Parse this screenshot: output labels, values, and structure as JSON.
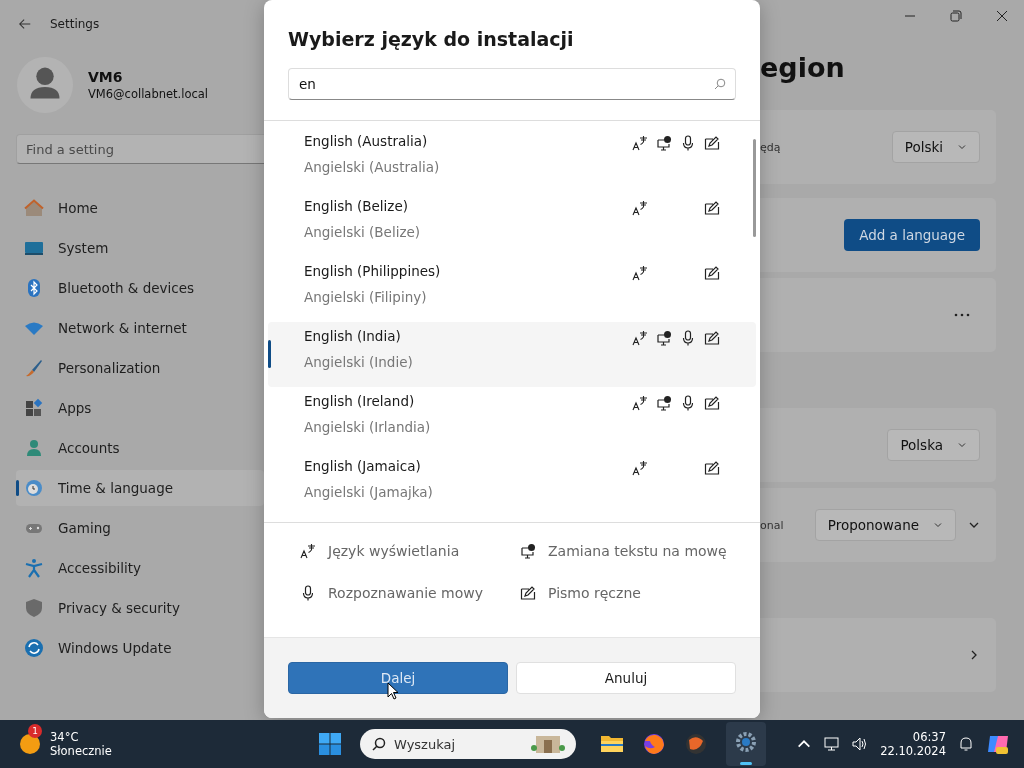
{
  "window": {
    "title": "Settings"
  },
  "user": {
    "name": "VM6",
    "email": "VM6@collabnet.local"
  },
  "sidebar": {
    "search": {
      "placeholder": "Find a setting"
    },
    "items": [
      {
        "label": "Home",
        "kind": "home",
        "selected": false
      },
      {
        "label": "System",
        "kind": "system",
        "selected": false
      },
      {
        "label": "Bluetooth & devices",
        "kind": "bluetooth",
        "selected": false
      },
      {
        "label": "Network & internet",
        "kind": "network",
        "selected": false
      },
      {
        "label": "Personalization",
        "kind": "brush",
        "selected": false
      },
      {
        "label": "Apps",
        "kind": "apps",
        "selected": false
      },
      {
        "label": "Accounts",
        "kind": "accounts",
        "selected": false
      },
      {
        "label": "Time & language",
        "kind": "time",
        "selected": true
      },
      {
        "label": "Gaming",
        "kind": "gaming",
        "selected": false
      },
      {
        "label": "Accessibility",
        "kind": "accessibility",
        "selected": false
      },
      {
        "label": "Privacy & security",
        "kind": "privacy",
        "selected": false
      },
      {
        "label": "Windows Update",
        "kind": "update",
        "selected": false
      }
    ]
  },
  "page": {
    "title": "egion",
    "cards": [
      {
        "kind": "dropdown",
        "label": "ędą",
        "value": "Polski"
      },
      {
        "kind": "button",
        "label": "Add a language"
      },
      {
        "kind": "more"
      },
      {
        "kind": "dropdown",
        "value": "Polska"
      },
      {
        "kind": "dropdown",
        "label": "onal",
        "value": "Proponowane",
        "expander": true
      },
      {
        "kind": "link"
      }
    ]
  },
  "dialog": {
    "title": "Wybierz język do instalacji",
    "search": {
      "value": "en"
    },
    "languages": [
      {
        "name": "English (Australia)",
        "native": "Angielski (Australia)",
        "display": true,
        "tts": true,
        "speech": true,
        "handwriting": true,
        "selected": false
      },
      {
        "name": "English (Belize)",
        "native": "Angielski (Belize)",
        "display": true,
        "tts": false,
        "speech": false,
        "handwriting": true,
        "selected": false
      },
      {
        "name": "English (Philippines)",
        "native": "Angielski (Filipiny)",
        "display": true,
        "tts": false,
        "speech": false,
        "handwriting": true,
        "selected": false
      },
      {
        "name": "English (India)",
        "native": "Angielski (Indie)",
        "display": true,
        "tts": true,
        "speech": true,
        "handwriting": true,
        "selected": true
      },
      {
        "name": "English (Ireland)",
        "native": "Angielski (Irlandia)",
        "display": true,
        "tts": true,
        "speech": true,
        "handwriting": true,
        "selected": false
      },
      {
        "name": "English (Jamaica)",
        "native": "Angielski (Jamajka)",
        "display": true,
        "tts": false,
        "speech": false,
        "handwriting": true,
        "selected": false
      }
    ],
    "legend": [
      {
        "kind": "display",
        "label": "Język wyświetlania"
      },
      {
        "kind": "tts",
        "label": "Zamiana tekstu na mowę"
      },
      {
        "kind": "speech",
        "label": "Rozpoznawanie mowy"
      },
      {
        "kind": "handwriting",
        "label": "Pismo ręczne"
      }
    ],
    "buttons": [
      {
        "label": "Dalej",
        "kind": "primary"
      },
      {
        "label": "Anuluj",
        "kind": "secondary"
      }
    ]
  },
  "taskbar": {
    "weather": {
      "badge": "1",
      "temp": "34°C",
      "condition": "Słonecznie"
    },
    "search": {
      "placeholder": "Wyszukaj"
    },
    "time": "06:37",
    "date": "22.10.2024"
  }
}
